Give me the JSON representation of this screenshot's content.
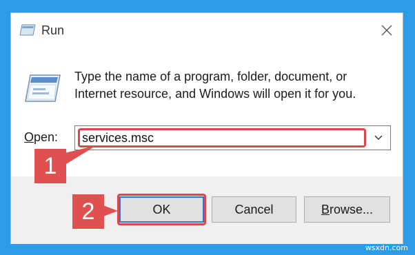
{
  "window": {
    "title": "Run",
    "close_icon": "close-icon",
    "app_icon": "run-icon"
  },
  "description": {
    "line1": "Type the name of a program, folder, document, or",
    "line2": "Internet resource, and Windows will open it for you."
  },
  "open_field": {
    "label_underlined": "O",
    "label_rest": "pen:",
    "value": "services.msc",
    "dropdown_icon": "chevron-down-icon"
  },
  "buttons": {
    "ok": "OK",
    "cancel": "Cancel",
    "browse_underlined": "B",
    "browse_rest": "rowse..."
  },
  "annotations": {
    "step1": "1",
    "step2": "2",
    "color": "#e05050"
  },
  "colors": {
    "background": "#2d9ce8",
    "highlight": "#d9484a",
    "default_button_border": "#2a7bd7"
  },
  "watermark": "wsxdn.com"
}
